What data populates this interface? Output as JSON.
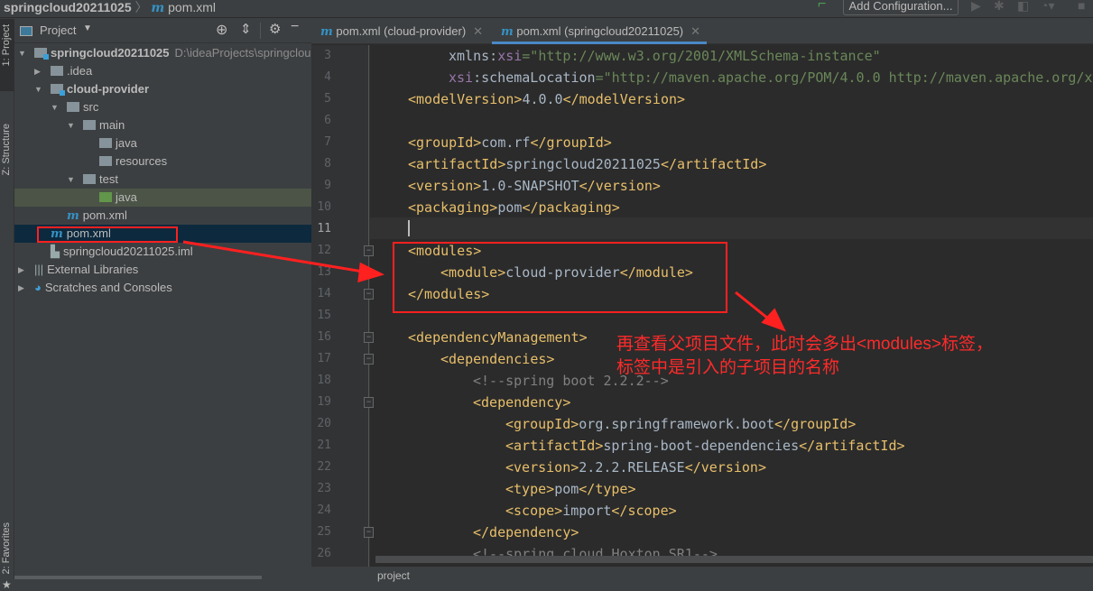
{
  "titlebar": {
    "project": "springcloud20211025",
    "separator": "〉",
    "file": "pom.xml",
    "add_configuration": "Add Configuration..."
  },
  "left_strip": {
    "project_tab": "1: Project",
    "structure_tab": "Z: Structure",
    "favorites_tab": "2: Favorites"
  },
  "project_panel": {
    "title": "Project",
    "icons": [
      "locate-icon",
      "collapse-icon",
      "gear-icon",
      "minimize-icon"
    ]
  },
  "tree": [
    {
      "label": "springcloud20211025",
      "path": "D:\\ideaProjects\\springclou",
      "level": 0,
      "expanded": true,
      "bold": true,
      "type": "module"
    },
    {
      "label": ".idea",
      "level": 1,
      "expanded": false,
      "type": "folder"
    },
    {
      "label": "cloud-provider",
      "level": 1,
      "expanded": true,
      "bold": true,
      "type": "module"
    },
    {
      "label": "src",
      "level": 2,
      "expanded": true,
      "type": "folder"
    },
    {
      "label": "main",
      "level": 3,
      "expanded": true,
      "type": "folder"
    },
    {
      "label": "java",
      "level": 4,
      "type": "folder"
    },
    {
      "label": "resources",
      "level": 4,
      "type": "folder"
    },
    {
      "label": "test",
      "level": 3,
      "expanded": true,
      "type": "folder"
    },
    {
      "label": "java",
      "level": 4,
      "type": "test-folder"
    },
    {
      "label": "pom.xml",
      "level": 2,
      "type": "maven"
    },
    {
      "label": "pom.xml",
      "level": 1,
      "type": "maven",
      "selected": true
    },
    {
      "label": "springcloud20211025.iml",
      "level": 1,
      "type": "iml"
    },
    {
      "label": "External Libraries",
      "level": 0,
      "expanded": false,
      "type": "libraries"
    },
    {
      "label": "Scratches and Consoles",
      "level": 0,
      "expanded": false,
      "type": "scratches"
    }
  ],
  "tabs": [
    {
      "label": "pom.xml (cloud-provider)",
      "active": false
    },
    {
      "label": "pom.xml (springcloud20211025)",
      "active": true
    }
  ],
  "code": [
    {
      "n": 3,
      "i": 9,
      "p": [
        [
          "x",
          "xmlns:"
        ],
        [
          "n",
          "xsi"
        ],
        [
          "s",
          "=\"http://www.w3.org/2001/XMLSchema-instance\""
        ]
      ]
    },
    {
      "n": 4,
      "i": 9,
      "p": [
        [
          "n",
          "xsi"
        ],
        [
          "x",
          ":schemaLocation"
        ],
        [
          "s",
          "=\"http://maven.apache.org/POM/4.0.0 http://maven.apache.org/xsd/maven-4.0.0.xsd\""
        ]
      ]
    },
    {
      "n": 5,
      "i": 4,
      "p": [
        [
          "t",
          "<modelVersion>"
        ],
        [
          "x",
          "4.0.0"
        ],
        [
          "t",
          "</modelVersion>"
        ]
      ]
    },
    {
      "n": 6,
      "i": 0,
      "p": []
    },
    {
      "n": 7,
      "i": 4,
      "p": [
        [
          "t",
          "<groupId>"
        ],
        [
          "x",
          "com.rf"
        ],
        [
          "t",
          "</groupId>"
        ]
      ]
    },
    {
      "n": 8,
      "i": 4,
      "p": [
        [
          "t",
          "<artifactId>"
        ],
        [
          "x",
          "springcloud20211025"
        ],
        [
          "t",
          "</artifactId>"
        ]
      ]
    },
    {
      "n": 9,
      "i": 4,
      "p": [
        [
          "t",
          "<version>"
        ],
        [
          "x",
          "1.0-SNAPSHOT"
        ],
        [
          "t",
          "</version>"
        ]
      ]
    },
    {
      "n": 10,
      "i": 4,
      "p": [
        [
          "t",
          "<packaging>"
        ],
        [
          "x",
          "pom"
        ],
        [
          "t",
          "</packaging>"
        ]
      ]
    },
    {
      "n": 11,
      "i": 4,
      "p": [],
      "current": true
    },
    {
      "n": 12,
      "i": 4,
      "p": [
        [
          "t",
          "<modules>"
        ]
      ]
    },
    {
      "n": 13,
      "i": 8,
      "p": [
        [
          "t",
          "<module>"
        ],
        [
          "x",
          "cloud-provider"
        ],
        [
          "t",
          "</module>"
        ]
      ]
    },
    {
      "n": 14,
      "i": 4,
      "p": [
        [
          "t",
          "</modules>"
        ]
      ]
    },
    {
      "n": 15,
      "i": 0,
      "p": []
    },
    {
      "n": 16,
      "i": 4,
      "p": [
        [
          "t",
          "<dependencyManagement>"
        ]
      ]
    },
    {
      "n": 17,
      "i": 8,
      "p": [
        [
          "t",
          "<dependencies>"
        ]
      ]
    },
    {
      "n": 18,
      "i": 12,
      "p": [
        [
          "c",
          "<!--spring boot 2.2.2-->"
        ]
      ]
    },
    {
      "n": 19,
      "i": 12,
      "p": [
        [
          "t",
          "<dependency>"
        ]
      ]
    },
    {
      "n": 20,
      "i": 16,
      "p": [
        [
          "t",
          "<groupId>"
        ],
        [
          "x",
          "org.springframework.boot"
        ],
        [
          "t",
          "</groupId>"
        ]
      ]
    },
    {
      "n": 21,
      "i": 16,
      "p": [
        [
          "t",
          "<artifactId>"
        ],
        [
          "x",
          "spring-boot-dependencies"
        ],
        [
          "t",
          "</artifactId>"
        ]
      ]
    },
    {
      "n": 22,
      "i": 16,
      "p": [
        [
          "t",
          "<version>"
        ],
        [
          "x",
          "2.2.2.RELEASE"
        ],
        [
          "t",
          "</version>"
        ]
      ]
    },
    {
      "n": 23,
      "i": 16,
      "p": [
        [
          "t",
          "<type>"
        ],
        [
          "x",
          "pom"
        ],
        [
          "t",
          "</type>"
        ]
      ]
    },
    {
      "n": 24,
      "i": 16,
      "p": [
        [
          "t",
          "<scope>"
        ],
        [
          "x",
          "import"
        ],
        [
          "t",
          "</scope>"
        ]
      ]
    },
    {
      "n": 25,
      "i": 12,
      "p": [
        [
          "t",
          "</dependency>"
        ]
      ]
    },
    {
      "n": 26,
      "i": 12,
      "p": [
        [
          "c",
          "<!--spring cloud Hoxton.SR1-->"
        ]
      ]
    }
  ],
  "fold_lines": [
    12,
    14,
    16,
    17,
    19,
    25
  ],
  "status": {
    "label": "project"
  },
  "annotation": {
    "line1": "再查看父项目文件，此时会多出<modules>标签，",
    "line2": "标签中是引入的子项目的名称",
    "color": "#ff2a2a"
  },
  "colors": {
    "tag": "#e8bf6a",
    "string": "#6a8759",
    "namespace": "#9876aa",
    "comment": "#808080",
    "text": "#a9b7c6",
    "accent": "#4a88c7"
  }
}
